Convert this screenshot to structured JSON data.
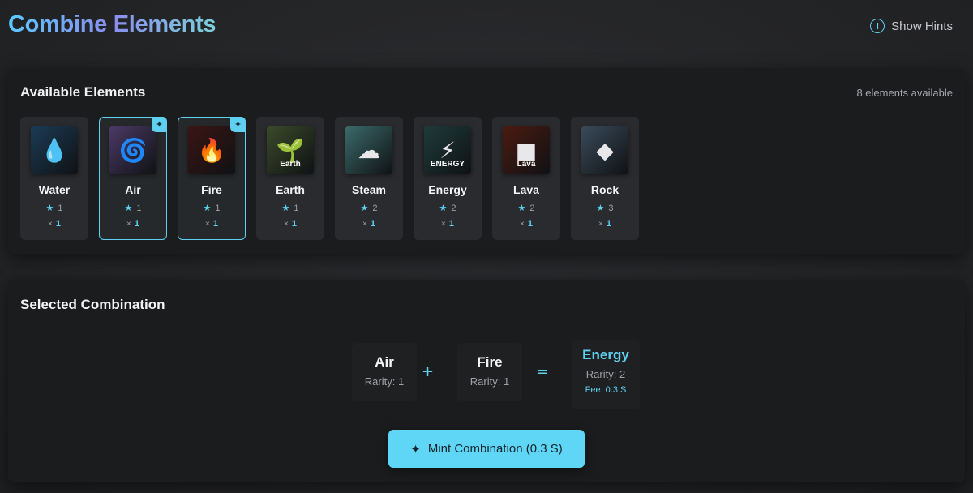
{
  "header": {
    "title": "Combine Elements",
    "hints_label": "Show Hints",
    "hints_icon": "info-icon"
  },
  "available": {
    "title": "Available Elements",
    "count_text": "8 elements available",
    "elements": [
      {
        "name": "Water",
        "rarity": "1",
        "qty": "1",
        "selected": false,
        "icon": "water-drop-icon",
        "glyph": "💧",
        "bg": "#1b3b55"
      },
      {
        "name": "Air",
        "rarity": "1",
        "qty": "1",
        "selected": true,
        "icon": "air-swirl-icon",
        "glyph": "🌀",
        "bg": "#4a3a66"
      },
      {
        "name": "Fire",
        "rarity": "1",
        "qty": "1",
        "selected": true,
        "icon": "flame-icon",
        "glyph": "🔥",
        "bg": "#3a1414"
      },
      {
        "name": "Earth",
        "rarity": "1",
        "qty": "1",
        "selected": false,
        "icon": "earth-sprout-icon",
        "glyph": "🌱",
        "bg": "#3a4a2a"
      },
      {
        "name": "Steam",
        "rarity": "2",
        "qty": "1",
        "selected": false,
        "icon": "steam-cloud-icon",
        "glyph": "☁",
        "bg": "#3b6a6a"
      },
      {
        "name": "Energy",
        "rarity": "2",
        "qty": "1",
        "selected": false,
        "icon": "energy-bolt-icon",
        "glyph": "⚡",
        "bg": "#1f3a3a"
      },
      {
        "name": "Lava",
        "rarity": "2",
        "qty": "1",
        "selected": false,
        "icon": "lava-cube-icon",
        "glyph": "■",
        "bg": "#4a1a10"
      },
      {
        "name": "Rock",
        "rarity": "3",
        "qty": "1",
        "selected": false,
        "icon": "rock-icon",
        "glyph": "◆",
        "bg": "#3a4a5a"
      }
    ],
    "thumb_words": {
      "Earth": "Earth",
      "Energy": "ENERGY",
      "Lava": "Lava"
    },
    "qty_prefix": "×",
    "star_glyph": "★",
    "selected_badge_icon": "sparkle-icon"
  },
  "selected": {
    "title": "Selected Combination",
    "first": {
      "name": "Air",
      "rarity": "Rarity: 1"
    },
    "second": {
      "name": "Fire",
      "rarity": "Rarity: 1"
    },
    "plus": "+",
    "equals": "=",
    "result": {
      "name": "Energy",
      "rarity": "Rarity: 2",
      "fee": "Fee: 0.3 S"
    },
    "mint_label": "Mint Combination (0.3 S)",
    "mint_icon": "sparkle-icon"
  },
  "colors": {
    "accent": "#5fd0f0",
    "panel": "#1b1c1e",
    "card": "#2a2b2e"
  }
}
